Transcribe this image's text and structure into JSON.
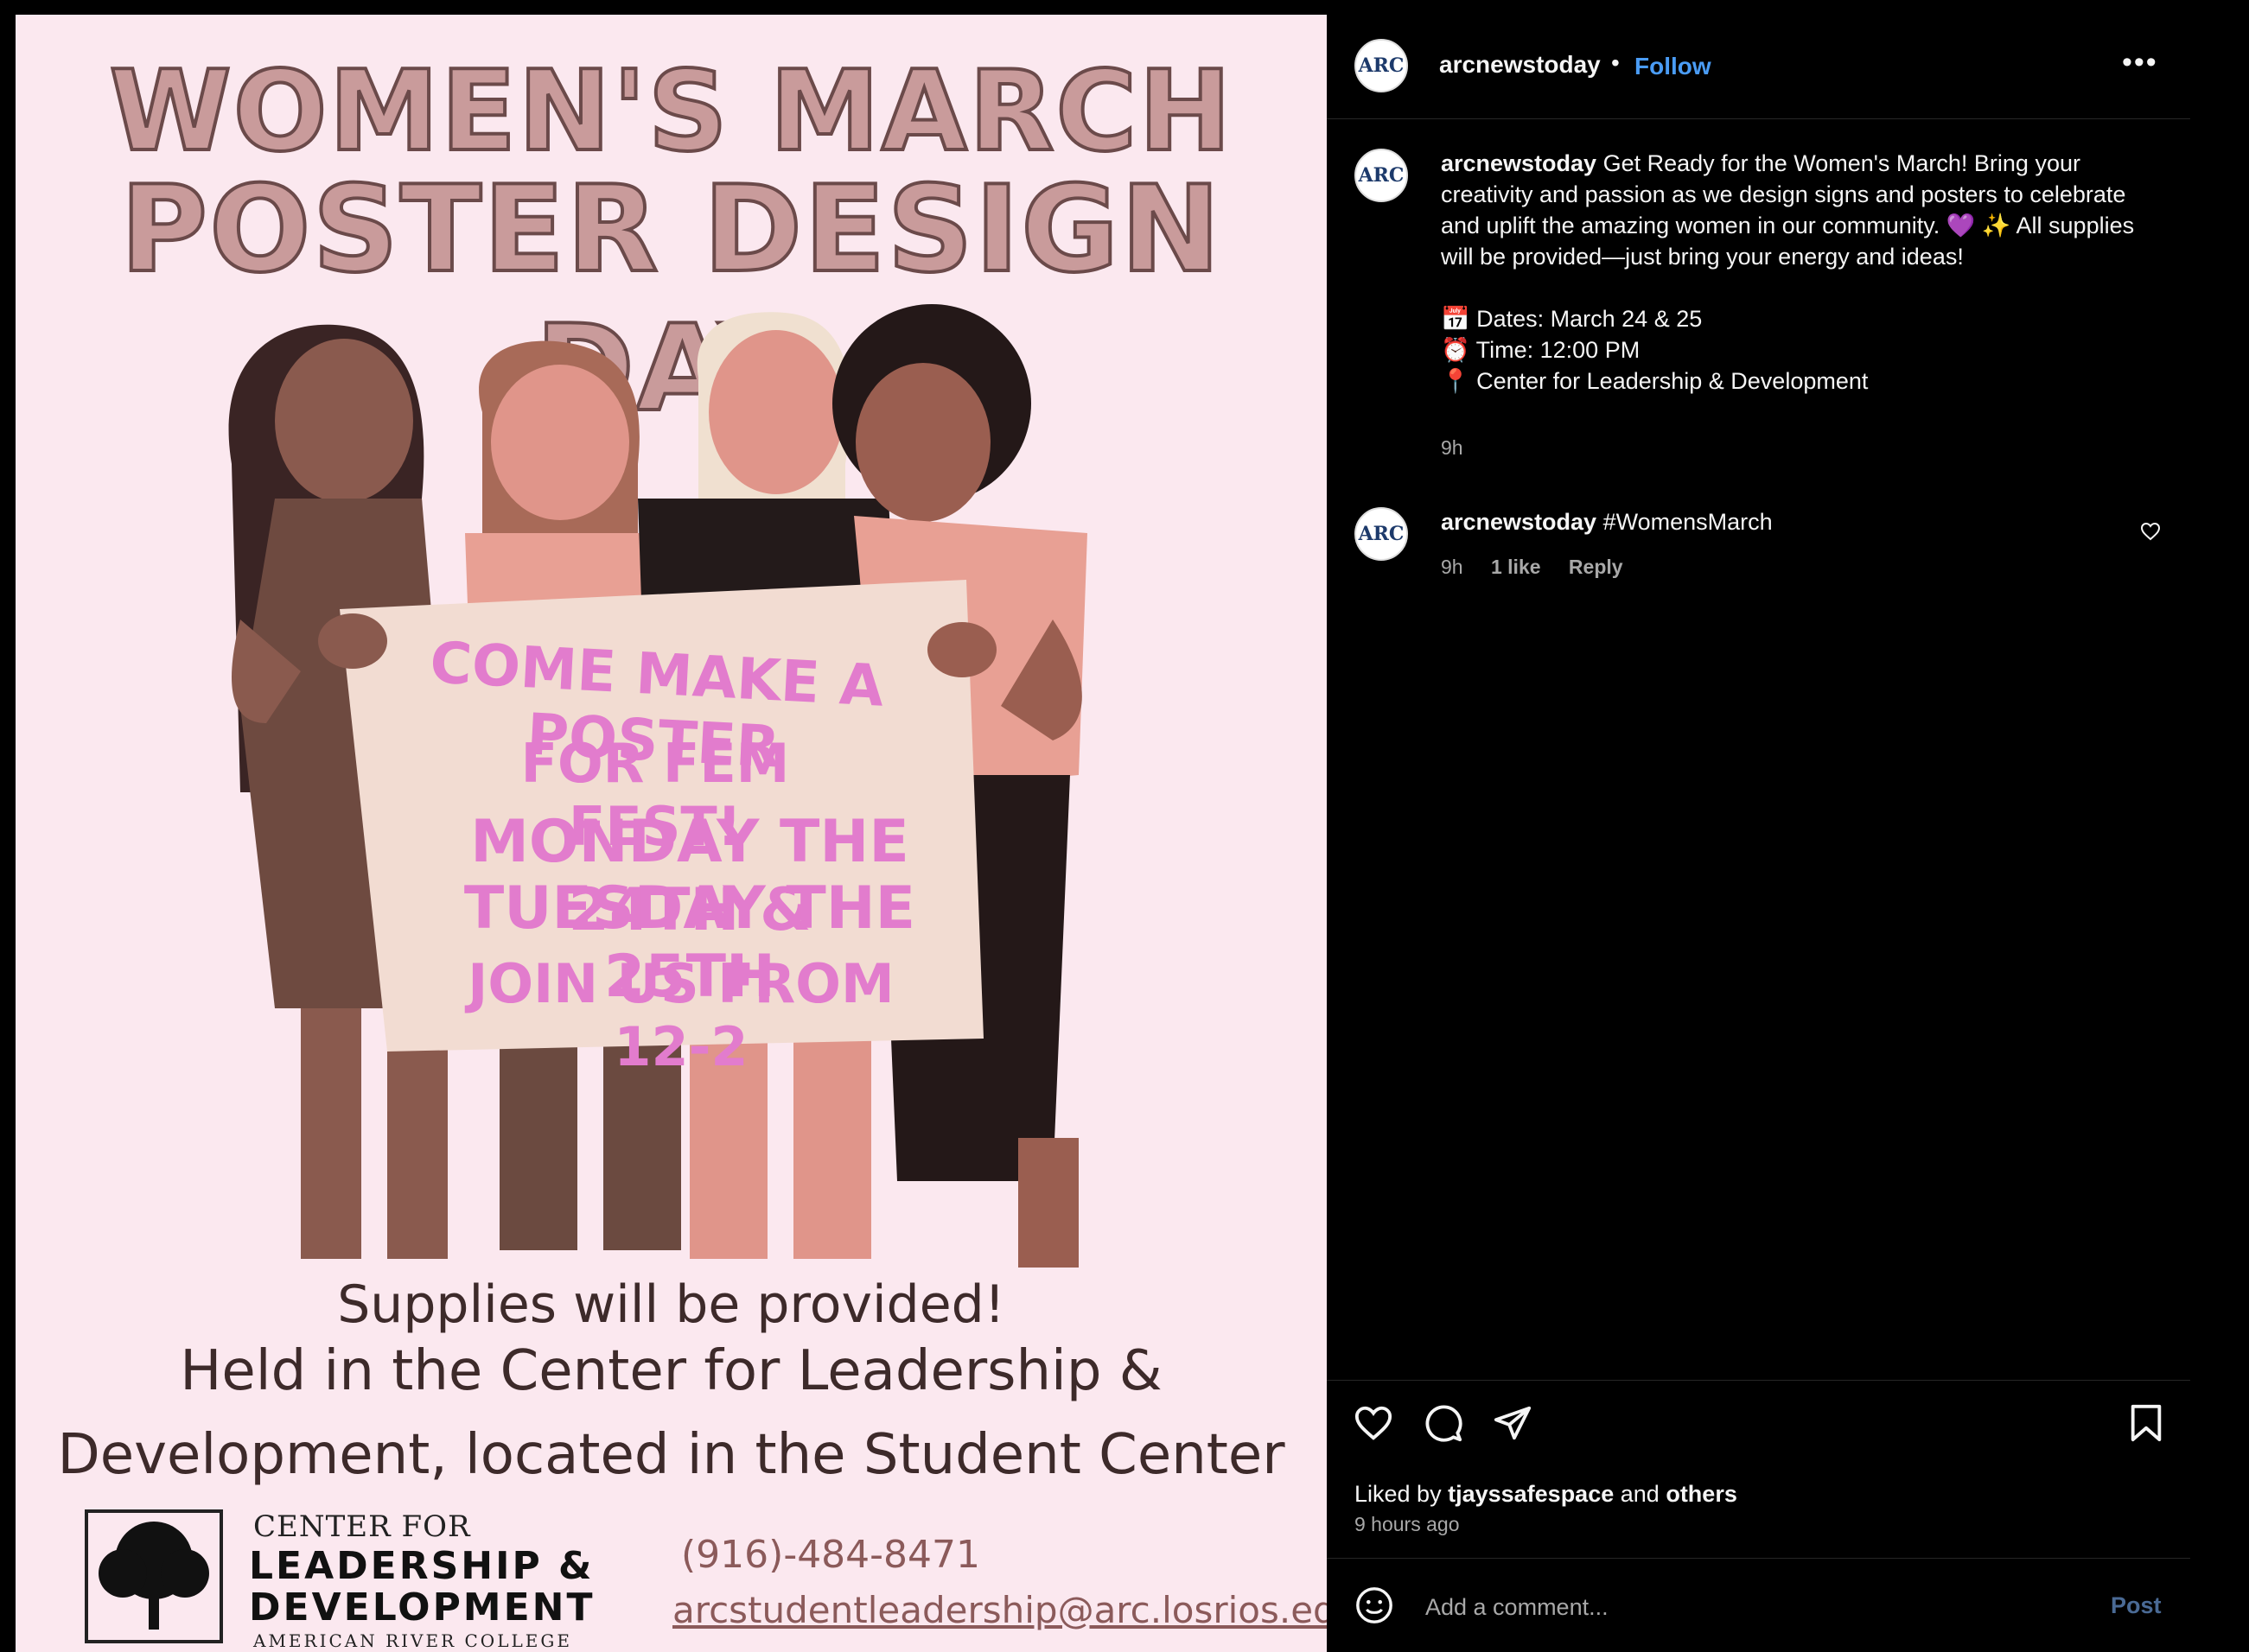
{
  "poster": {
    "title_line1": "WOMEN'S MARCH",
    "title_line2": "POSTER DESIGN DAY",
    "banner_line1": "COME MAKE A POSTER",
    "banner_line2": "FOR FEM FEST!",
    "banner_line3": "MONDAY THE 24TH &",
    "banner_line4": "TUESDAY THE 25TH",
    "banner_line5": "JOIN US FROM 12-2",
    "info_line1": "Supplies will be provided!",
    "info_line2": "Held in the Center for Leadership &",
    "info_line3": "Development, located in the Student Center",
    "logo_line1": "CENTER FOR",
    "logo_line2": "LEADERSHIP &",
    "logo_line3": "DEVELOPMENT",
    "logo_line4": "AMERICAN RIVER COLLEGE",
    "phone": "(916)-484-8471",
    "email": "arcstudentleadership@arc.losrios.edu"
  },
  "header": {
    "avatar_text": "ARC",
    "username": "arcnewstoday",
    "dot": "•",
    "follow_label": "Follow",
    "more_label": "•••"
  },
  "caption": {
    "username": "arcnewstoday",
    "line1": "Get Ready for the Women's March! Bring your creativity and passion as we design signs and posters to celebrate and uplift the amazing women in our community. 💜 ✨ All supplies will be provided—just bring your energy and ideas!",
    "dates": "📅 Dates: March 24 & 25",
    "time": "⏰ Time: 12:00 PM",
    "location": "📍 Center for Leadership & Development",
    "timestamp": "9h"
  },
  "comment": {
    "username": "arcnewstoday",
    "text": "#WomensMarch",
    "time": "9h",
    "likes": "1 like",
    "reply_label": "Reply"
  },
  "engagement": {
    "liked_by_prefix": "Liked by",
    "liked_by_user": "tjayssafespace",
    "and": "and",
    "others": "others",
    "time_ago": "9 hours ago"
  },
  "comment_box": {
    "placeholder": "Add a comment...",
    "post_label": "Post"
  },
  "icons": [
    "heart-icon",
    "comment-icon",
    "share-icon",
    "bookmark-icon",
    "emoji-icon",
    "more-icon"
  ]
}
